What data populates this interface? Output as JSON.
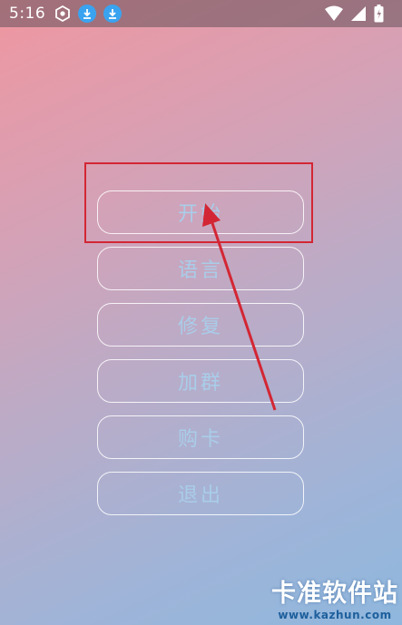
{
  "status_bar": {
    "time": "5:16",
    "icons": [
      "app-notification-icon",
      "download-icon",
      "download-icon",
      "wifi-icon",
      "signal-icon",
      "battery-icon"
    ]
  },
  "menu": {
    "items": [
      {
        "label": "开始"
      },
      {
        "label": "语言"
      },
      {
        "label": "修复"
      },
      {
        "label": "加群"
      },
      {
        "label": "购卡"
      },
      {
        "label": "退出"
      }
    ]
  },
  "annotation": {
    "color": "#d32634"
  },
  "watermark": {
    "title": "卡准软件站",
    "url": "www.kazhun.com"
  }
}
